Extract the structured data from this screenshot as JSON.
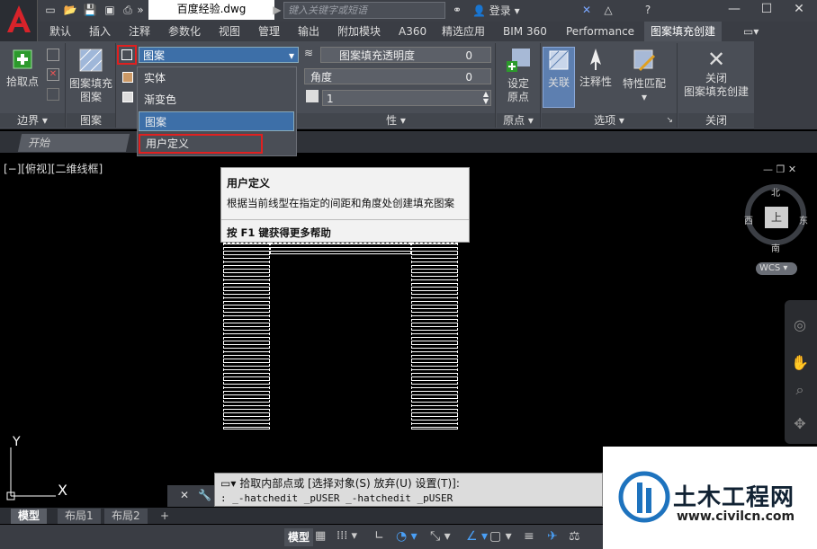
{
  "title": {
    "doc": "百度经验.dwg",
    "search_placeholder": "键入关键字或短语",
    "login": "登录"
  },
  "ribbon_tabs": [
    "默认",
    "插入",
    "注释",
    "参数化",
    "视图",
    "管理",
    "输出",
    "附加模块",
    "A360",
    "精选应用",
    "BIM 360",
    "Performance",
    "图案填充创建"
  ],
  "ribbon": {
    "pick_point": "拾取点",
    "hatch_pattern": "图案填充",
    "hatch_pattern2": "图案",
    "type_value": "图案",
    "transparency_label": "图案填充透明度",
    "transparency_value": "0",
    "angle_label": "角度",
    "angle_value": "0",
    "scale_value": "1",
    "set_origin": "设定",
    "set_origin2": "原点",
    "associative": "关联",
    "annotative": "注释性",
    "match_props": "特性匹配",
    "close": "关闭",
    "close2": "图案填充创建",
    "groups": {
      "boundary": "边界",
      "pattern": "图案",
      "props": "性",
      "origin": "原点",
      "options": "选项",
      "close": "关闭"
    }
  },
  "dropdown": {
    "items": [
      "实体",
      "渐变色",
      "图案",
      "用户定义"
    ]
  },
  "file_tab": "开始",
  "view_label": "[−][俯视][二维线框]",
  "tooltip": {
    "title": "用户定义",
    "desc": "根据当前线型在指定的间距和角度处创建填充图案",
    "help_prefix": "按 ",
    "help_key": "F1",
    "help_suffix": " 键获得更多帮助"
  },
  "compass": {
    "n": "北",
    "s": "南",
    "e": "东",
    "w": "西",
    "center": "上",
    "wcs": "WCS"
  },
  "command": {
    "prompt": "拾取内部点或 [选择对象(S) 放弃(U) 设置(T)]:",
    "history": ": _-hatchedit _pUSER _-hatchedit _pUSER"
  },
  "layout_tabs": [
    "模型",
    "布局1",
    "布局2"
  ],
  "status": {
    "model": "模型"
  },
  "watermark": {
    "name": "土木工程网",
    "url": "www.civilcn.com"
  },
  "axis": {
    "y": "Y",
    "x": "X"
  },
  "colors": {
    "accent": "#c0392b",
    "ribbon_bg": "#4a4e56",
    "dropdown_highlight": "#3d6fa8"
  }
}
